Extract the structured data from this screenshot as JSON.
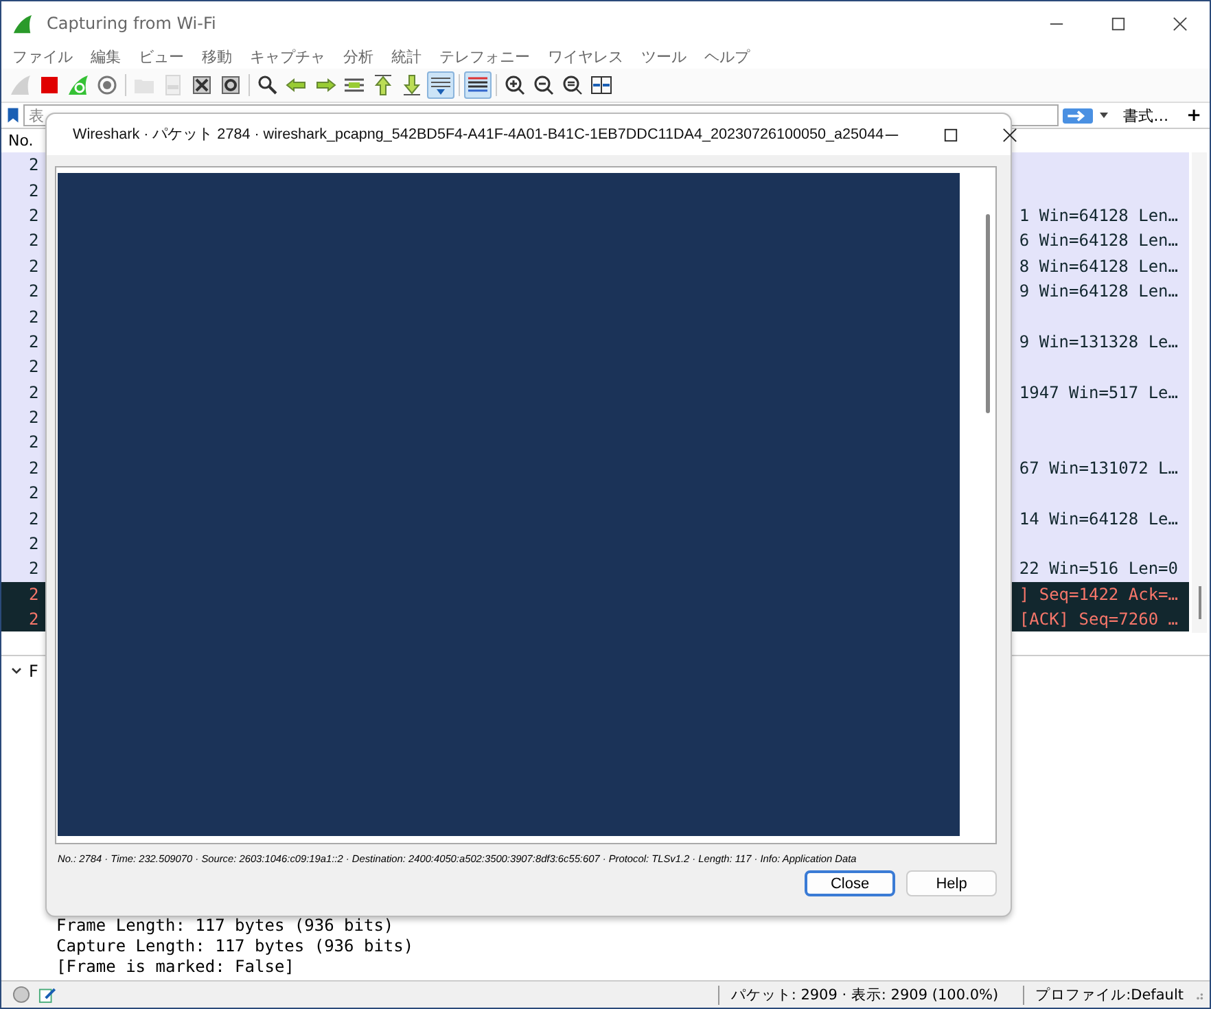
{
  "window": {
    "title": "Capturing from Wi-Fi"
  },
  "menu": [
    "ファイル",
    "編集",
    "ビュー",
    "移動",
    "キャプチャ",
    "分析",
    "統計",
    "テレフォニー",
    "ワイヤレス",
    "ツール",
    "ヘルプ"
  ],
  "toolbar": [
    {
      "buttons": [
        {
          "kind": "fin",
          "disabled": true,
          "selected": false
        },
        {
          "kind": "stop",
          "disabled": false,
          "selected": false
        },
        {
          "kind": "restart",
          "disabled": false,
          "selected": false
        },
        {
          "kind": "options",
          "disabled": false,
          "selected": false
        }
      ]
    },
    {
      "buttons": [
        {
          "kind": "folder",
          "disabled": true,
          "selected": false
        },
        {
          "kind": "file",
          "disabled": true,
          "selected": false
        },
        {
          "kind": "closefile",
          "disabled": false,
          "selected": false
        },
        {
          "kind": "reload",
          "disabled": false,
          "selected": false
        }
      ]
    },
    {
      "buttons": [
        {
          "kind": "search",
          "disabled": false,
          "selected": false
        },
        {
          "kind": "back",
          "disabled": false,
          "selected": false
        },
        {
          "kind": "forward",
          "disabled": false,
          "selected": false
        },
        {
          "kind": "goto",
          "disabled": false,
          "selected": false
        },
        {
          "kind": "first",
          "disabled": false,
          "selected": false
        },
        {
          "kind": "last",
          "disabled": false,
          "selected": false
        },
        {
          "kind": "autoscroll",
          "disabled": false,
          "selected": true
        }
      ]
    },
    {
      "buttons": [
        {
          "kind": "colorize",
          "disabled": false,
          "selected": true
        }
      ]
    },
    {
      "buttons": [
        {
          "kind": "zoomin",
          "disabled": false,
          "selected": false
        },
        {
          "kind": "zoomout",
          "disabled": false,
          "selected": false
        },
        {
          "kind": "zoomreset",
          "disabled": false,
          "selected": false
        },
        {
          "kind": "resize",
          "disabled": false,
          "selected": false
        }
      ]
    }
  ],
  "filter": {
    "placeholder": "表",
    "format_label": "書式…",
    "add_label": "+"
  },
  "packet_list": {
    "columns": [
      "No."
    ],
    "rows": [
      {
        "no": "2",
        "info": "",
        "kind": "normal"
      },
      {
        "no": "2",
        "info": "",
        "kind": "normal"
      },
      {
        "no": "2",
        "info": "1 Win=64128 Len…",
        "kind": "normal"
      },
      {
        "no": "2",
        "info": "6 Win=64128 Len…",
        "kind": "normal"
      },
      {
        "no": "2",
        "info": "8 Win=64128 Len…",
        "kind": "normal"
      },
      {
        "no": "2",
        "info": "9 Win=64128 Len…",
        "kind": "normal"
      },
      {
        "no": "2",
        "info": "",
        "kind": "normal"
      },
      {
        "no": "2",
        "info": "9 Win=131328 Le…",
        "kind": "normal"
      },
      {
        "no": "2",
        "info": "",
        "kind": "normal"
      },
      {
        "no": "2",
        "info": "1947 Win=517 Le…",
        "kind": "normal"
      },
      {
        "no": "2",
        "info": "",
        "kind": "normal"
      },
      {
        "no": "2",
        "info": "",
        "kind": "normal"
      },
      {
        "no": "2",
        "info": "67 Win=131072 L…",
        "kind": "normal"
      },
      {
        "no": "2",
        "info": "",
        "kind": "normal"
      },
      {
        "no": "2",
        "info": "14 Win=64128 Le…",
        "kind": "normal"
      },
      {
        "no": "2",
        "info": "",
        "kind": "normal"
      },
      {
        "no": "2",
        "info": "22 Win=516 Len=0",
        "kind": "normal"
      },
      {
        "no": "2",
        "info": "] Seq=1422 Ack=…",
        "kind": "alert"
      },
      {
        "no": "2",
        "info": "[ACK] Seq=7260 …",
        "kind": "alert"
      }
    ]
  },
  "details": {
    "header": "F",
    "lines": [
      "Frame Length: 117 bytes (936 bits)",
      "Capture Length: 117 bytes (936 bits)",
      "[Frame is marked: False]"
    ]
  },
  "status": {
    "packets": "パケット: 2909 · 表示: 2909 (100.0%)",
    "profile": "プロファイル:Default"
  },
  "dialog": {
    "title": "Wireshark · パケット 2784 · wireshark_pcapng_542BD5F4-A41F-4A01-B41C-1EB7DDC11DA4_20230726100050_a25044",
    "content": {
      "kind": "redacted"
    },
    "info": "No.: 2784 · Time: 232.509070 · Source: 2603:1046:c09:19a1::2 · Destination: 2400:4050:a502:3500:3907:8df3:6c55:607 · Protocol: TLSv1.2 · Length: 117 · Info: Application Data",
    "buttons": [
      {
        "label": "Close",
        "selected": true
      },
      {
        "label": "Help",
        "selected": false
      }
    ]
  }
}
